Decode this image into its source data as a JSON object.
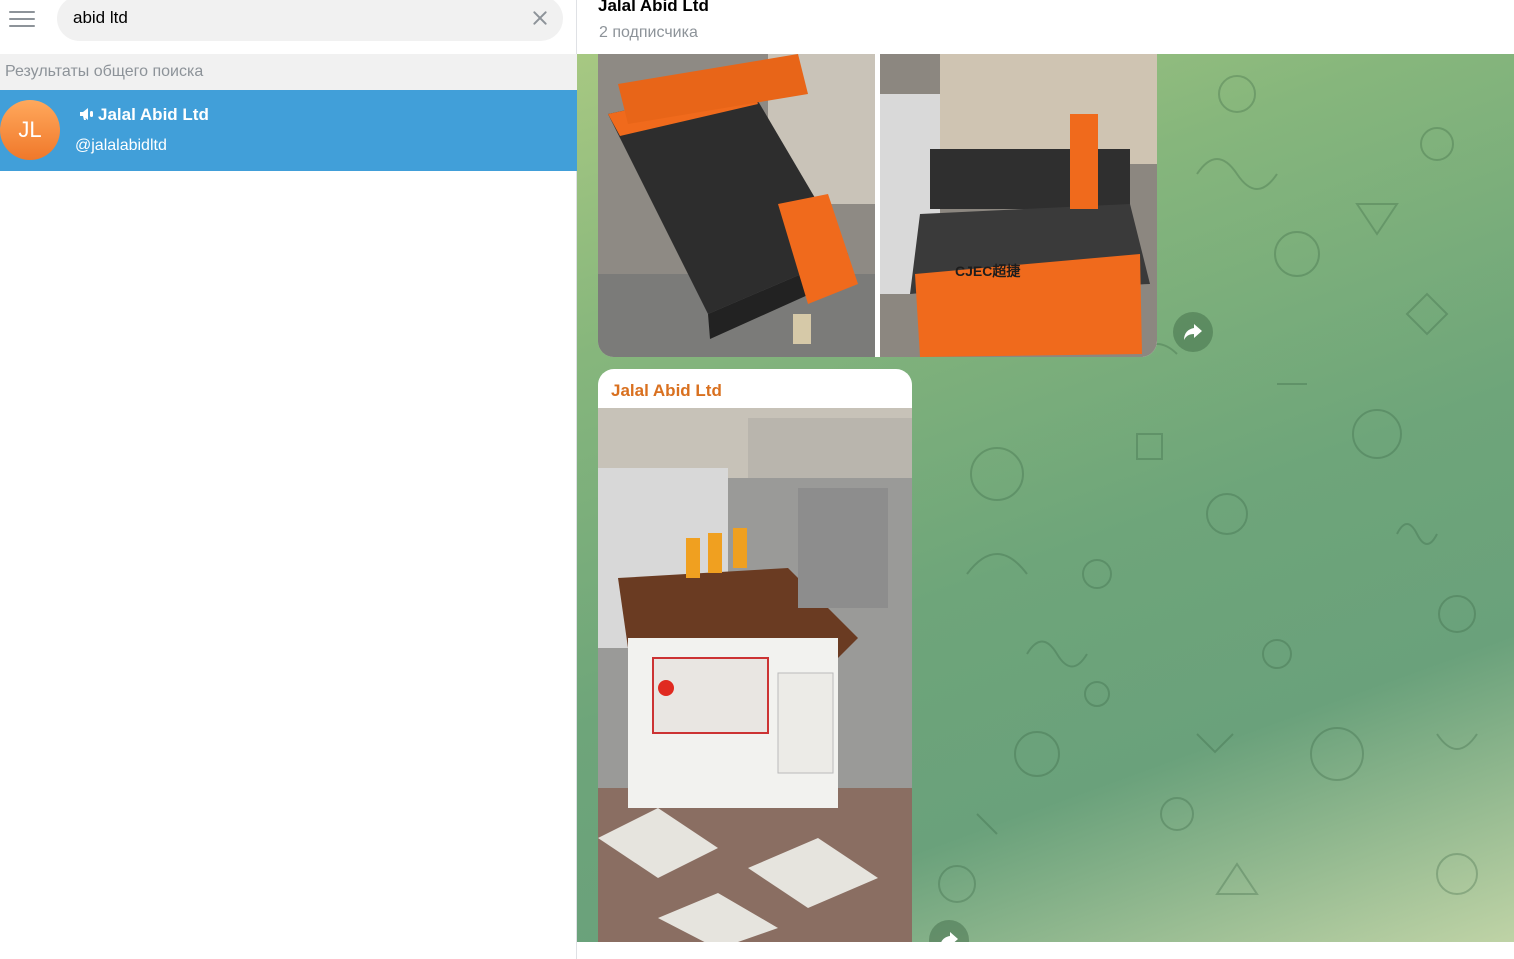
{
  "search": {
    "query": "abid ltd",
    "clear_icon": "close-icon",
    "menu_icon": "hamburger-menu-icon"
  },
  "results": {
    "header": "Результаты общего поиска",
    "items": [
      {
        "avatar_initials": "JL",
        "type_icon": "megaphone-icon",
        "name": "Jalal Abid Ltd",
        "handle": "@jalalabidltd"
      }
    ]
  },
  "chat": {
    "title": "Jalal Abid Ltd",
    "subtitle": "2 подписчика",
    "messages": [
      {
        "kind": "photo-album",
        "photos": [
          "cnc-router-photo",
          "cnc-router-photo"
        ],
        "share_icon": "share-arrow-icon"
      },
      {
        "kind": "photo",
        "author": "Jalal Abid Ltd",
        "photos": [
          "edge-banding-machine-photo"
        ],
        "share_icon": "share-arrow-icon"
      }
    ]
  },
  "colors": {
    "selection": "#419fd9",
    "author": "#d9701f",
    "avatar": "#f0782a",
    "muted_text": "#8d9399",
    "search_bg": "#f1f1f1"
  }
}
